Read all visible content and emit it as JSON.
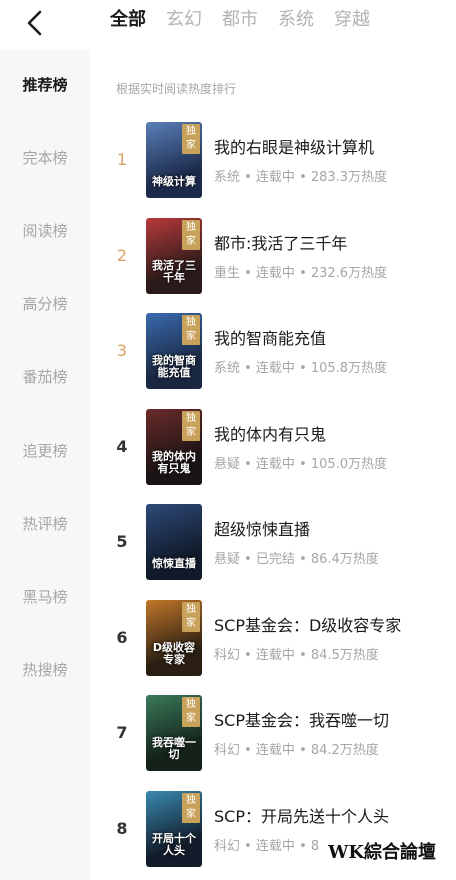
{
  "nav": {
    "back_icon": "chevron-left-icon",
    "tabs": [
      {
        "label": "全部",
        "active": true
      },
      {
        "label": "玄幻",
        "active": false
      },
      {
        "label": "都市",
        "active": false
      },
      {
        "label": "系统",
        "active": false
      },
      {
        "label": "穿越",
        "active": false
      }
    ]
  },
  "sidebar": {
    "items": [
      {
        "label": "推荐榜",
        "active": true
      },
      {
        "label": "完本榜",
        "active": false
      },
      {
        "label": "阅读榜",
        "active": false
      },
      {
        "label": "高分榜",
        "active": false
      },
      {
        "label": "番茄榜",
        "active": false
      },
      {
        "label": "追更榜",
        "active": false
      },
      {
        "label": "热评榜",
        "active": false
      },
      {
        "label": "黑马榜",
        "active": false
      },
      {
        "label": "热搜榜",
        "active": false
      }
    ]
  },
  "main": {
    "subtitle": "根据实时阅读热度排行",
    "exclusive_label": "独家",
    "books": [
      {
        "rank": "1",
        "title": "我的右眼是神级计算机",
        "meta": "系统 • 连载中 • 283.3万热度",
        "exclusive": true,
        "cover_text": "神级计算",
        "cover_colors": [
          "#1b2a4a",
          "#5a7fb8"
        ]
      },
      {
        "rank": "2",
        "title": "都市:我活了三千年",
        "meta": "重生 • 连载中 • 232.6万热度",
        "exclusive": true,
        "cover_text": "我活了三千年",
        "cover_colors": [
          "#2a1a1a",
          "#b83a3a"
        ]
      },
      {
        "rank": "3",
        "title": "我的智商能充值",
        "meta": "系统 • 连载中 • 105.8万热度",
        "exclusive": true,
        "cover_text": "我的智商能充值",
        "cover_colors": [
          "#1a2740",
          "#3a6ab0"
        ]
      },
      {
        "rank": "4",
        "title": "我的体内有只鬼",
        "meta": "悬疑 • 连载中 • 105.0万热度",
        "exclusive": true,
        "cover_text": "我的体内有只鬼",
        "cover_colors": [
          "#1a1414",
          "#6b2a2a"
        ]
      },
      {
        "rank": "5",
        "title": "超级惊悚直播",
        "meta": "悬疑 • 已完结 • 86.4万热度",
        "exclusive": false,
        "cover_text": "惊悚直播",
        "cover_colors": [
          "#101a2a",
          "#2e4a78"
        ]
      },
      {
        "rank": "6",
        "title": "SCP基金会：D级收容专家",
        "meta": "科幻 • 连载中 • 84.5万热度",
        "exclusive": true,
        "cover_text": "D级收容专家",
        "cover_colors": [
          "#2a1f12",
          "#c2772a"
        ]
      },
      {
        "rank": "7",
        "title": "SCP基金会：我吞噬一切",
        "meta": "科幻 • 连载中 • 84.2万热度",
        "exclusive": true,
        "cover_text": "我吞噬一切",
        "cover_colors": [
          "#14221a",
          "#3a7a5a"
        ]
      },
      {
        "rank": "8",
        "title": "SCP：开局先送十个人头",
        "meta": "科幻 • 连载中 • 8",
        "exclusive": true,
        "cover_text": "开局十个人头",
        "cover_colors": [
          "#121c2a",
          "#3a8ab0"
        ]
      }
    ]
  },
  "watermark": "WK綜合論壇",
  "colors": {
    "accent_rank": "#d9a263",
    "badge": "#c8a15b",
    "sidebar_bg": "#f7f7f7"
  }
}
